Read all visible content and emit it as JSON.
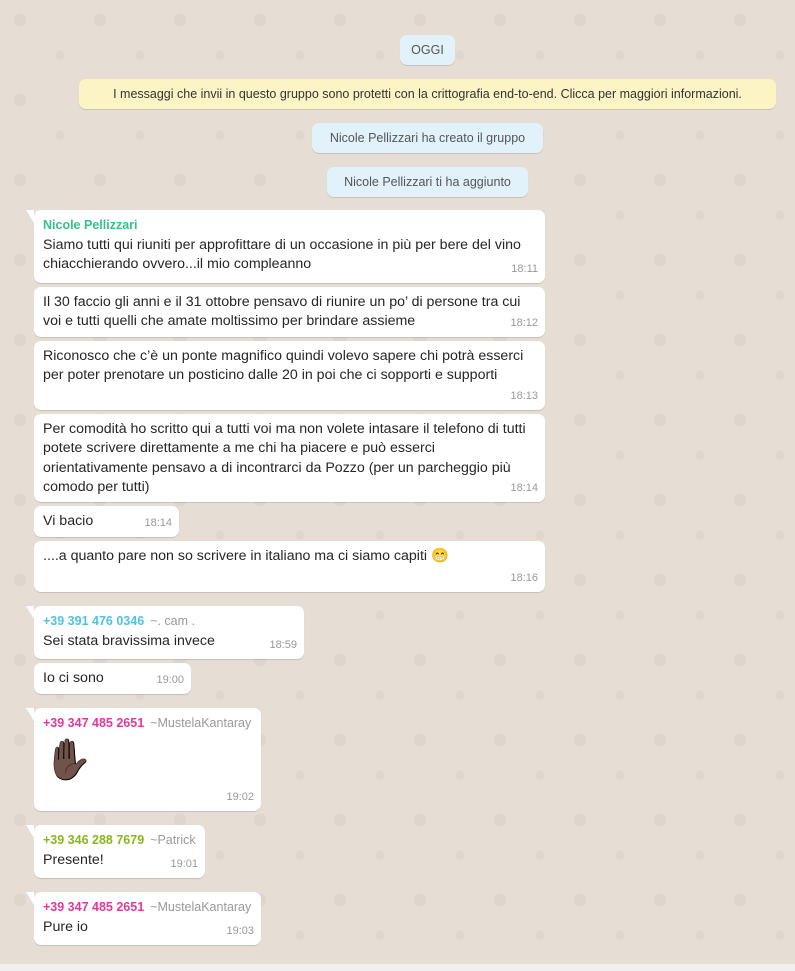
{
  "system": {
    "day": "OGGI",
    "encryption": "I messaggi che invii in questo gruppo sono protetti con la crittografia end-to-end. Clicca per maggiori informazioni.",
    "created": "Nicole Pellizzari ha creato il gruppo",
    "added": "Nicole Pellizzari ti ha aggiunto"
  },
  "colors": {
    "nicole": "#35c28a",
    "cam": "#4fc3e0",
    "mustela": "#e0399b",
    "patrick": "#8ab51f"
  },
  "messages": [
    {
      "sender": "Nicole Pellizzari",
      "text": "Siamo tutti qui riuniti per approfittare di un occasione in più per bere del vino chiacchierando ovvero...il mio compleanno",
      "time": "18:11"
    },
    {
      "text": "Il 30 faccio gli anni e il 31 ottobre pensavo di riunire un po’ di persone tra cui voi e tutti quelli che amate moltissimo per brindare assieme",
      "time": "18:12"
    },
    {
      "text": "Riconosco che c’è un ponte magnifico quindi volevo sapere chi potrà esserci per poter prenotare un posticino dalle 20 in poi che ci sopporti e supporti",
      "time": "18:13"
    },
    {
      "text": "Per comodità ho scritto qui a tutti voi ma non volete intasare il telefono di tutti potete scrivere direttamente a me chi ha piacere e può esserci orientativamente pensavo a di incontrarci da Pozzo (per un parcheggio più comodo per tutti)",
      "time": "18:14"
    },
    {
      "text": "Vi bacio",
      "time": "18:14"
    },
    {
      "text": "....a quanto pare non so scrivere in italiano ma ci siamo capiti 😁",
      "time": "18:16"
    },
    {
      "sender": "+39 391 476 0346",
      "alias": "~. cam .",
      "text": "Sei stata bravissima invece",
      "time": "18:59"
    },
    {
      "text": "Io ci sono",
      "time": "19:00"
    },
    {
      "sender": "+39 347 485 2651",
      "alias": "~MustelaKantaray",
      "text": "✋🏿",
      "time": "19:02"
    },
    {
      "sender": "+39 346 288 7679",
      "alias": "~Patrick",
      "text": "Presente!",
      "time": "19:01"
    },
    {
      "sender": "+39 347 485 2651",
      "alias": "~MustelaKantaray",
      "text": "Pure io",
      "time": "19:03"
    }
  ]
}
